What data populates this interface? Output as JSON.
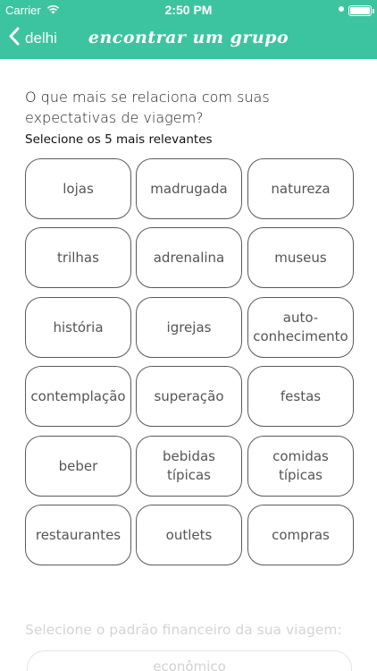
{
  "status_bar": {
    "carrier": "Carrier",
    "time": "2:50 PM"
  },
  "nav": {
    "back_label": "delhi",
    "title": "encontrar um grupo",
    "color": "#3cc4a0"
  },
  "question": "O que mais se relaciona com suas expectativas de viagem?",
  "subtitle": "Selecione os 5 mais relevantes",
  "options": [
    "lojas",
    "madrugada",
    "natureza",
    "trilhas",
    "adrenalina",
    "museus",
    "história",
    "igrejas",
    "auto-\nconhecimento",
    "contemplação",
    "superação",
    "festas",
    "beber",
    "bebidas\ntípicas",
    "comidas\ntípicas",
    "restaurantes",
    "outlets",
    "compras"
  ],
  "finance": {
    "label": "Selecione o padrão financeiro da sua viagem:",
    "first_option": "econômico"
  }
}
